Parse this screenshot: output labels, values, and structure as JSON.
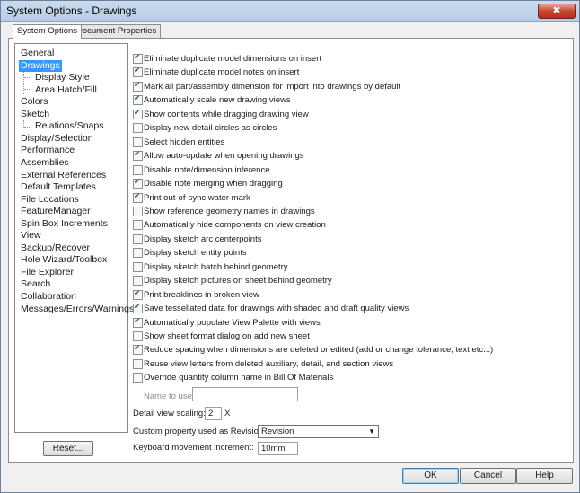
{
  "window": {
    "title": "System Options - Drawings",
    "close_label": "✖"
  },
  "tabs": [
    {
      "label": "System Options",
      "active": true
    },
    {
      "label": "Document Properties",
      "active": false
    }
  ],
  "nav": {
    "items": [
      {
        "label": "General"
      },
      {
        "label": "Drawings",
        "selected": true
      },
      {
        "label": "Display Style",
        "child": true
      },
      {
        "label": "Area Hatch/Fill",
        "child": true
      },
      {
        "label": "Colors"
      },
      {
        "label": "Sketch"
      },
      {
        "label": "Relations/Snaps",
        "child": true
      },
      {
        "label": "Display/Selection"
      },
      {
        "label": "Performance"
      },
      {
        "label": "Assemblies"
      },
      {
        "label": "External References"
      },
      {
        "label": "Default Templates"
      },
      {
        "label": "File Locations"
      },
      {
        "label": "FeatureManager"
      },
      {
        "label": "Spin Box Increments"
      },
      {
        "label": "View"
      },
      {
        "label": "Backup/Recover"
      },
      {
        "label": "Hole Wizard/Toolbox"
      },
      {
        "label": "File Explorer"
      },
      {
        "label": "Search"
      },
      {
        "label": "Collaboration"
      },
      {
        "label": "Messages/Errors/Warnings"
      }
    ],
    "reset_label": "Reset..."
  },
  "options": [
    {
      "label": "Eliminate duplicate model dimensions on insert",
      "checked": true
    },
    {
      "label": "Eliminate duplicate model notes on insert",
      "checked": true
    },
    {
      "label": "Mark all part/assembly dimension for import into drawings by default",
      "checked": true
    },
    {
      "label": "Automatically scale new drawing views",
      "checked": true
    },
    {
      "label": "Show contents while dragging drawing view",
      "checked": true
    },
    {
      "label": "Display new detail circles as circles",
      "checked": false
    },
    {
      "label": "Select hidden entities",
      "checked": false
    },
    {
      "label": "Allow auto-update when opening drawings",
      "checked": true
    },
    {
      "label": "Disable note/dimension inference",
      "checked": false
    },
    {
      "label": "Disable note merging when dragging",
      "checked": true
    },
    {
      "label": "Print out-of-sync water mark",
      "checked": true
    },
    {
      "label": "Show reference geometry names in drawings",
      "checked": false
    },
    {
      "label": "Automatically hide components on view creation",
      "checked": false
    },
    {
      "label": "Display sketch arc centerpoints",
      "checked": false
    },
    {
      "label": "Display sketch entity points",
      "checked": false
    },
    {
      "label": "Display sketch hatch behind geometry",
      "checked": false
    },
    {
      "label": "Display sketch pictures on sheet behind geometry",
      "checked": false
    },
    {
      "label": "Print breaklines in broken view",
      "checked": true
    },
    {
      "label": "Save tessellated data for drawings with shaded and draft quality views",
      "checked": true
    },
    {
      "label": "Automatically populate View Palette with views",
      "checked": true
    },
    {
      "label": "Show sheet format dialog on add new sheet",
      "checked": false
    },
    {
      "label": "Reduce spacing when dimensions are deleted or edited (add or change tolerance, text etc...)",
      "checked": true
    },
    {
      "label": "Reuse view letters from deleted auxiliary, detail, and section views",
      "checked": false
    },
    {
      "label": "Override quantity column name in Bill Of Materials",
      "checked": false
    }
  ],
  "name_to_use": {
    "label": "Name to use:",
    "value": ""
  },
  "detail_scaling": {
    "label": "Detail view scaling:",
    "value": "2",
    "unit": "X"
  },
  "custom_property": {
    "label": "Custom property used as Revision:",
    "value": "Revision"
  },
  "keyboard_increment": {
    "label": "Keyboard movement increment:",
    "value": "10mm"
  },
  "buttons": {
    "ok": "OK",
    "cancel": "Cancel",
    "help": "Help"
  }
}
